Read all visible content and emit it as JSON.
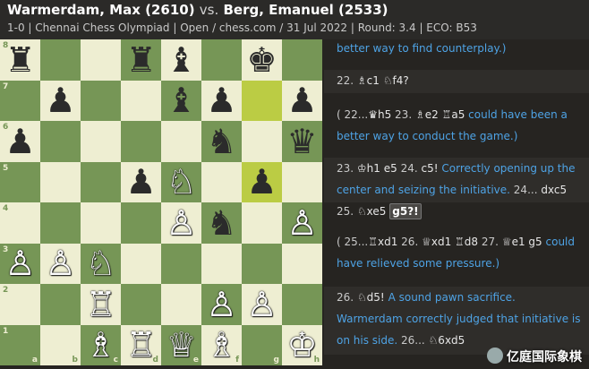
{
  "header": {
    "white_player": "Warmerdam, Max (2610)",
    "vs": "vs.",
    "black_player": "Berg, Emanuel (2533)",
    "game_info": "1-0 | Chennai Chess Olympiad | Open / chess.com / 31 Jul 2022 | Round: 3.4 | ECO: B53"
  },
  "board": {
    "files": [
      "a",
      "b",
      "c",
      "d",
      "e",
      "f",
      "g",
      "h"
    ],
    "ranks": [
      "8",
      "7",
      "6",
      "5",
      "4",
      "3",
      "2",
      "1"
    ],
    "highlight": [
      "g7",
      "g5"
    ],
    "position": {
      "a8": "br",
      "d8": "br",
      "e8": "bb",
      "g8": "bk",
      "b7": "bp",
      "e7": "bb",
      "f7": "bp",
      "h7": "bp",
      "a6": "bp",
      "f6": "bn",
      "h6": "bq",
      "d5": "bp",
      "e5": "wn",
      "g5": "bp",
      "e4": "wp",
      "f4": "bn",
      "h4": "wp",
      "a3": "wp",
      "b3": "wp",
      "c3": "wn",
      "c2": "wr",
      "f2": "wp",
      "g2": "wp",
      "c1": "wb",
      "d1": "wr",
      "e1": "wq",
      "f1": "wb",
      "h1": "wk"
    },
    "glyphs": {
      "wk": "♔",
      "wq": "♕",
      "wr": "♖",
      "wb": "♗",
      "wn": "♘",
      "wp": "♙",
      "bk": "♚",
      "bq": "♛",
      "br": "♜",
      "bb": "♝",
      "bn": "♞",
      "bp": "♟"
    }
  },
  "notation": {
    "b1_text": "better way to find counterplay.)",
    "b2_num": "22.",
    "b2_m1": "♗c1",
    "b2_m2": "♘f4?",
    "b3_open": "( 22...",
    "b3_m1": "♛h5",
    "b3_num2": "23.",
    "b3_m2": "♗e2",
    "b3_m3": "♖a5",
    "b3_text": "could have been a better way to conduct the game.)",
    "b4_num": "23.",
    "b4_m1": "♔h1",
    "b4_m2": "e5",
    "b4_num2": "24.",
    "b4_m3": "c5!",
    "b4_text": "Correctly opening up the center and seizing the initiative.",
    "b4_num3": "24...",
    "b4_m4": "dxc5",
    "b4_num4": "25.",
    "b4_m5": "♘xe5",
    "b4_tag": "g5?!",
    "b5_open": "( 25...",
    "b5_m1": "♖xd1",
    "b5_num2": "26.",
    "b5_m2": "♕xd1",
    "b5_m3": "♖d8",
    "b5_num3": "27.",
    "b5_m4": "♕e1",
    "b5_m5": "g5",
    "b5_text": "could have relieved some pressure.)",
    "b6_num": "26.",
    "b6_m1": "♘d5!",
    "b6_text": "A sound pawn sacrifice. Warmerdam correctly judged that initiative is on his side.",
    "b6_num2": "26...",
    "b6_m2": "♘6xd5",
    "watermark": "亿庭国际象棋"
  }
}
